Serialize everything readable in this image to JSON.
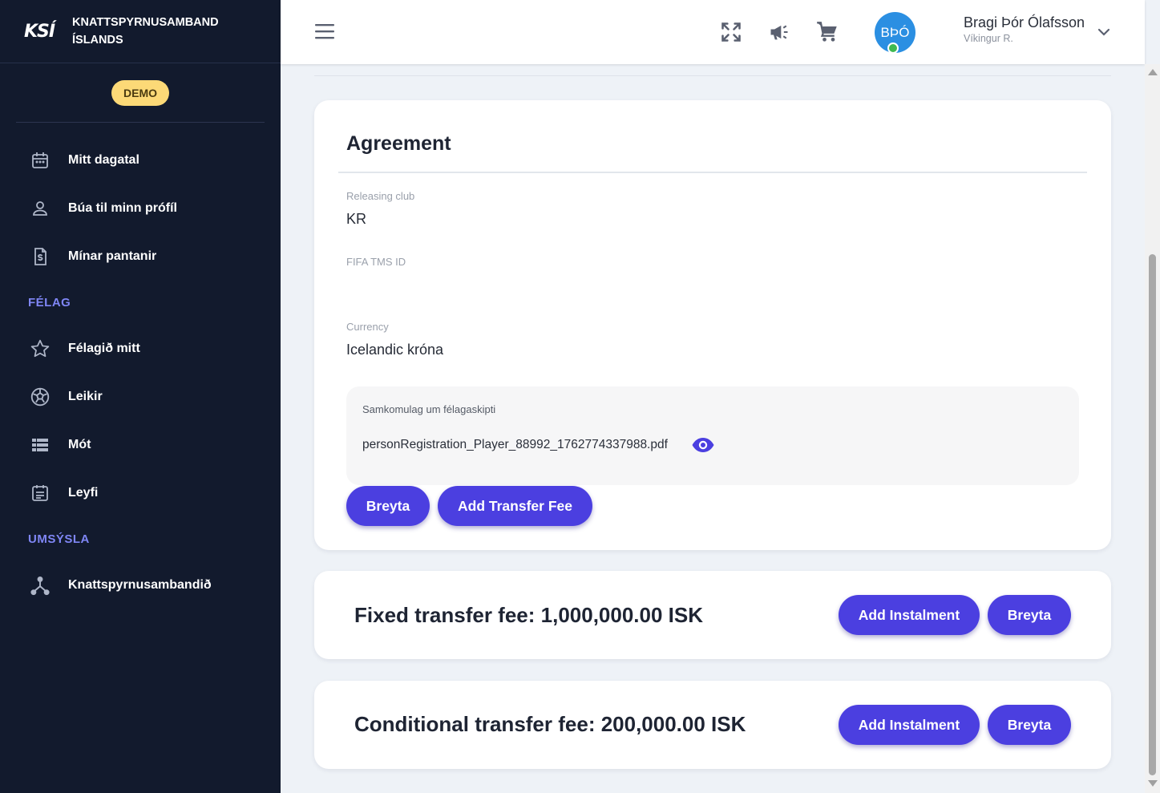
{
  "brand": {
    "logo": "KSÍ",
    "name_line1": "KNATTSPYRNUSAMBAND",
    "name_line2": "ÍSLANDS"
  },
  "demo_badge": "DEMO",
  "sidebar": {
    "items": [
      {
        "label": "Mitt dagatal",
        "icon": "calendar-icon"
      },
      {
        "label": "Búa til minn prófíl",
        "icon": "person-icon"
      },
      {
        "label": "Mínar pantanir",
        "icon": "invoice-icon"
      }
    ],
    "sections": [
      {
        "title": "FÉLAG",
        "items": [
          {
            "label": "Félagið mitt",
            "icon": "star-icon"
          },
          {
            "label": "Leikir",
            "icon": "soccer-ball-icon"
          },
          {
            "label": "Mót",
            "icon": "table-list-icon"
          },
          {
            "label": "Leyfi",
            "icon": "license-icon"
          }
        ]
      },
      {
        "title": "UMSÝSLA",
        "items": [
          {
            "label": "Knattspyrnusambandið",
            "icon": "hierarchy-icon"
          }
        ]
      }
    ]
  },
  "header": {
    "icons": [
      "menu-icon",
      "fullscreen-icon",
      "megaphone-icon",
      "cart-icon"
    ],
    "user": {
      "initials": "BÞÓ",
      "name": "Bragi Þór Ólafsson",
      "club": "Víkingur R."
    }
  },
  "agreement": {
    "title": "Agreement",
    "fields": [
      {
        "label": "Releasing club",
        "value": "KR"
      },
      {
        "label": "FIFA TMS ID",
        "value": ""
      },
      {
        "label": "Currency",
        "value": "Icelandic króna"
      }
    ],
    "document": {
      "label": "Samkomulag um félagaskipti",
      "filename": "personRegistration_Player_88992_1762774337988.pdf"
    },
    "buttons": {
      "edit": "Breyta",
      "add_fee": "Add Transfer Fee"
    }
  },
  "fees": [
    {
      "title": "Fixed transfer fee: 1,000,000.00 ISK",
      "add_label": "Add Instalment",
      "edit_label": "Breyta"
    },
    {
      "title": "Conditional transfer fee: 200,000.00 ISK",
      "add_label": "Add Instalment",
      "edit_label": "Breyta"
    }
  ]
}
